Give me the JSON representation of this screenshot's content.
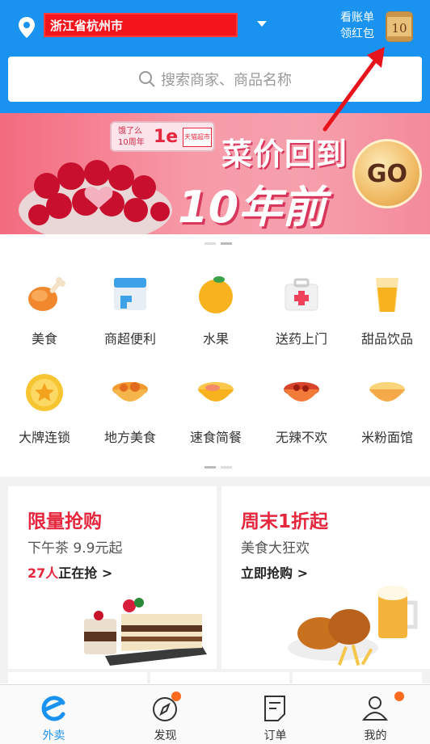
{
  "header": {
    "address": "浙江省杭州市",
    "bill_line1": "看账单",
    "bill_line2": "领红包",
    "bill_badge": "10"
  },
  "search": {
    "placeholder": "搜索商家、商品名称"
  },
  "banner": {
    "logo_tag": "饿了么 10周年",
    "logo_brand": "1e",
    "logo_store": "天猫超市",
    "title": "菜价回到",
    "subtitle": "10年前",
    "go_label": "GO"
  },
  "categories": [
    {
      "label": "美食",
      "icon": "drumstick-icon"
    },
    {
      "label": "商超便利",
      "icon": "store-icon"
    },
    {
      "label": "水果",
      "icon": "orange-icon"
    },
    {
      "label": "送药上门",
      "icon": "first-aid-icon"
    },
    {
      "label": "甜品饮品",
      "icon": "juice-icon"
    },
    {
      "label": "大牌连锁",
      "icon": "star-coin-icon"
    },
    {
      "label": "地方美食",
      "icon": "bowl-icon"
    },
    {
      "label": "速食简餐",
      "icon": "bowl-noodle-icon"
    },
    {
      "label": "无辣不欢",
      "icon": "spicy-bowl-icon"
    },
    {
      "label": "米粉面馆",
      "icon": "rice-noodle-icon"
    }
  ],
  "promos": [
    {
      "title": "限量抢购",
      "subtitle": "下午茶 9.9元起",
      "cta_count": "27人",
      "cta_text": "正在抢 >"
    },
    {
      "title": "周末1折起",
      "subtitle": "美食大狂欢",
      "cta_count": "",
      "cta_text": "立即抢购 >"
    }
  ],
  "tabs": [
    {
      "label": "外卖",
      "icon": "eleme-icon",
      "active": true
    },
    {
      "label": "发现",
      "icon": "compass-icon",
      "badge": true
    },
    {
      "label": "订单",
      "icon": "order-icon"
    },
    {
      "label": "我的",
      "icon": "profile-icon",
      "badge": true
    }
  ],
  "colors": {
    "brand_blue": "#1a93f0",
    "promo_red": "#e5263d",
    "badge_orange": "#ff6a1f",
    "redaction": "#f4141c"
  }
}
